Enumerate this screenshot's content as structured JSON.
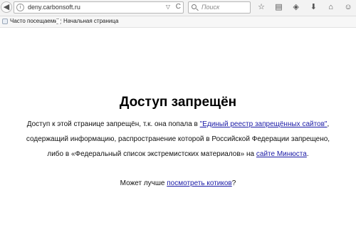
{
  "browser": {
    "url": "deny.carbonsoft.ru",
    "search_placeholder": "Поиск",
    "back_symbol": "◀",
    "info_symbol": "i",
    "dropdown_symbol": "▽",
    "reload_symbol": "C",
    "toolbar_icons": [
      "star-icon",
      "clipboard-icon",
      "pocket-icon",
      "download-icon",
      "home-icon",
      "chat-icon"
    ],
    "toolbar_glyphs": [
      "☆",
      "▤",
      "◈",
      "⬇",
      "⌂",
      "☺"
    ]
  },
  "bookmarks": {
    "items": [
      {
        "label": "Часто посещаемые"
      },
      {
        "label": "Начальная страница"
      }
    ]
  },
  "page": {
    "title": "Доступ запрещён",
    "line1_prefix": "Доступ к этой странице запрещён, т.к. она попала в ",
    "line1_link": "\"Единый реестр запрещённых сайтов\"",
    "line1_suffix": ",",
    "line2": "содержащий информацию, распространение которой в Российской Федерации запрещено,",
    "line3_prefix": "либо в «Федеральный список экстремистских материалов» на ",
    "line3_link": "сайте Минюста",
    "line3_suffix": ".",
    "line4_prefix": "Может лучше ",
    "line4_link": "посмотреть котиков",
    "line4_suffix": "?",
    "link_color": "#1a1aa6"
  }
}
